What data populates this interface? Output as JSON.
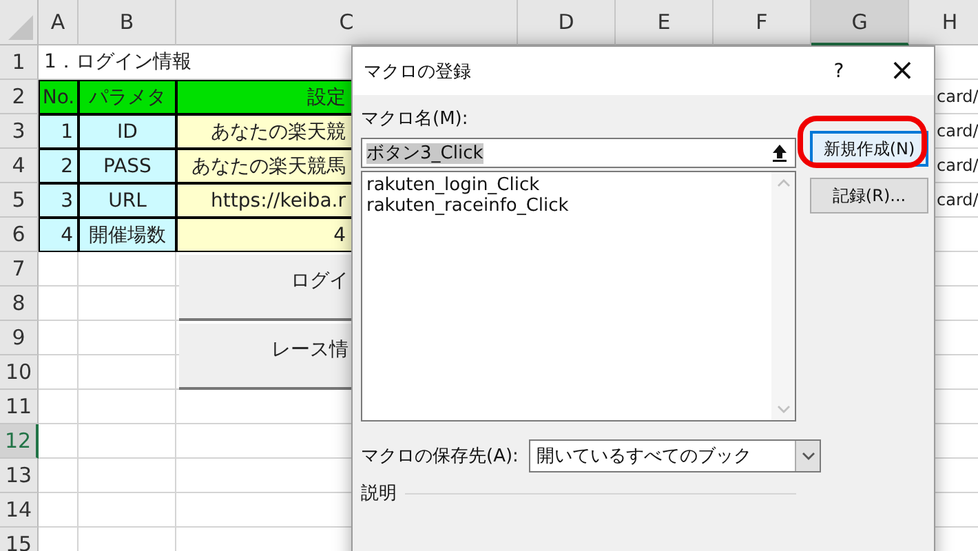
{
  "sheet": {
    "columns": [
      {
        "label": "A",
        "selected": false
      },
      {
        "label": "B",
        "selected": false
      },
      {
        "label": "C",
        "selected": false
      },
      {
        "label": "D",
        "selected": false
      },
      {
        "label": "E",
        "selected": false
      },
      {
        "label": "F",
        "selected": false
      },
      {
        "label": "G",
        "selected": true
      },
      {
        "label": "H",
        "selected": false
      }
    ],
    "rows": [
      {
        "header": "1",
        "selected": false,
        "cells": [
          {
            "kind": "title",
            "text": "1．ログイン情報"
          },
          {
            "kind": "plain"
          },
          {
            "kind": "plain"
          },
          {
            "kind": "plain"
          },
          {
            "kind": "plain"
          },
          {
            "kind": "plain"
          }
        ]
      },
      {
        "header": "2",
        "selected": false,
        "cells": [
          {
            "kind": "head",
            "text": "No."
          },
          {
            "kind": "head",
            "text": "パラメタ"
          },
          {
            "kind": "headvalue",
            "text": "設定"
          },
          {
            "kind": "plain"
          },
          {
            "kind": "plain"
          },
          {
            "kind": "plain"
          },
          {
            "kind": "plain"
          },
          {
            "kind": "tail",
            "text": "card/"
          }
        ]
      },
      {
        "header": "3",
        "selected": false,
        "cells": [
          {
            "kind": "num",
            "text": "1"
          },
          {
            "kind": "param",
            "text": "ID"
          },
          {
            "kind": "value",
            "text": "あなたの楽天競"
          },
          {
            "kind": "plain"
          },
          {
            "kind": "plain"
          },
          {
            "kind": "plain"
          },
          {
            "kind": "plain"
          },
          {
            "kind": "tail",
            "text": "card/"
          }
        ]
      },
      {
        "header": "4",
        "selected": false,
        "cells": [
          {
            "kind": "num",
            "text": "2"
          },
          {
            "kind": "param",
            "text": "PASS"
          },
          {
            "kind": "value",
            "text": "あなたの楽天競馬"
          },
          {
            "kind": "plain"
          },
          {
            "kind": "plain"
          },
          {
            "kind": "plain"
          },
          {
            "kind": "plain"
          },
          {
            "kind": "tail",
            "text": "card/"
          }
        ]
      },
      {
        "header": "5",
        "selected": false,
        "cells": [
          {
            "kind": "num",
            "text": "3"
          },
          {
            "kind": "param",
            "text": "URL"
          },
          {
            "kind": "value",
            "text": "https://keiba.r"
          },
          {
            "kind": "plain"
          },
          {
            "kind": "plain"
          },
          {
            "kind": "plain"
          },
          {
            "kind": "plain"
          },
          {
            "kind": "tail",
            "text": "card/"
          }
        ]
      },
      {
        "header": "6",
        "selected": false,
        "cells": [
          {
            "kind": "num",
            "text": "4"
          },
          {
            "kind": "param",
            "text": "開催場数"
          },
          {
            "kind": "value",
            "text": "4"
          },
          {
            "kind": "plain"
          },
          {
            "kind": "plain"
          },
          {
            "kind": "plain"
          },
          {
            "kind": "plain"
          },
          {
            "kind": "plain"
          }
        ]
      },
      {
        "header": "7",
        "selected": false
      },
      {
        "header": "8",
        "selected": false
      },
      {
        "header": "9",
        "selected": false
      },
      {
        "header": "10",
        "selected": false
      },
      {
        "header": "11",
        "selected": false
      },
      {
        "header": "12",
        "selected": true
      },
      {
        "header": "13",
        "selected": false
      },
      {
        "header": "14",
        "selected": false
      },
      {
        "header": "15",
        "selected": false
      }
    ],
    "buttons": [
      {
        "label": "ログイ"
      },
      {
        "label": "レース情"
      }
    ]
  },
  "dialog": {
    "title": "マクロの登録",
    "help": "?",
    "close": "×",
    "name_label": "マクロ名(M):",
    "name_value": "ボタン3_Click",
    "macros": [
      {
        "label": "rakuten_login_Click",
        "selected": false
      },
      {
        "label": "rakuten_raceinfo_Click",
        "selected": false
      }
    ],
    "buttons": [
      {
        "label": "新規作成(N)",
        "focused": true,
        "highlighted": true
      },
      {
        "label": "記録(R)...",
        "focused": false,
        "highlighted": false
      }
    ],
    "store_label": "マクロの保存先(A):",
    "store_value": "開いているすべてのブック",
    "description_label": "説明"
  }
}
